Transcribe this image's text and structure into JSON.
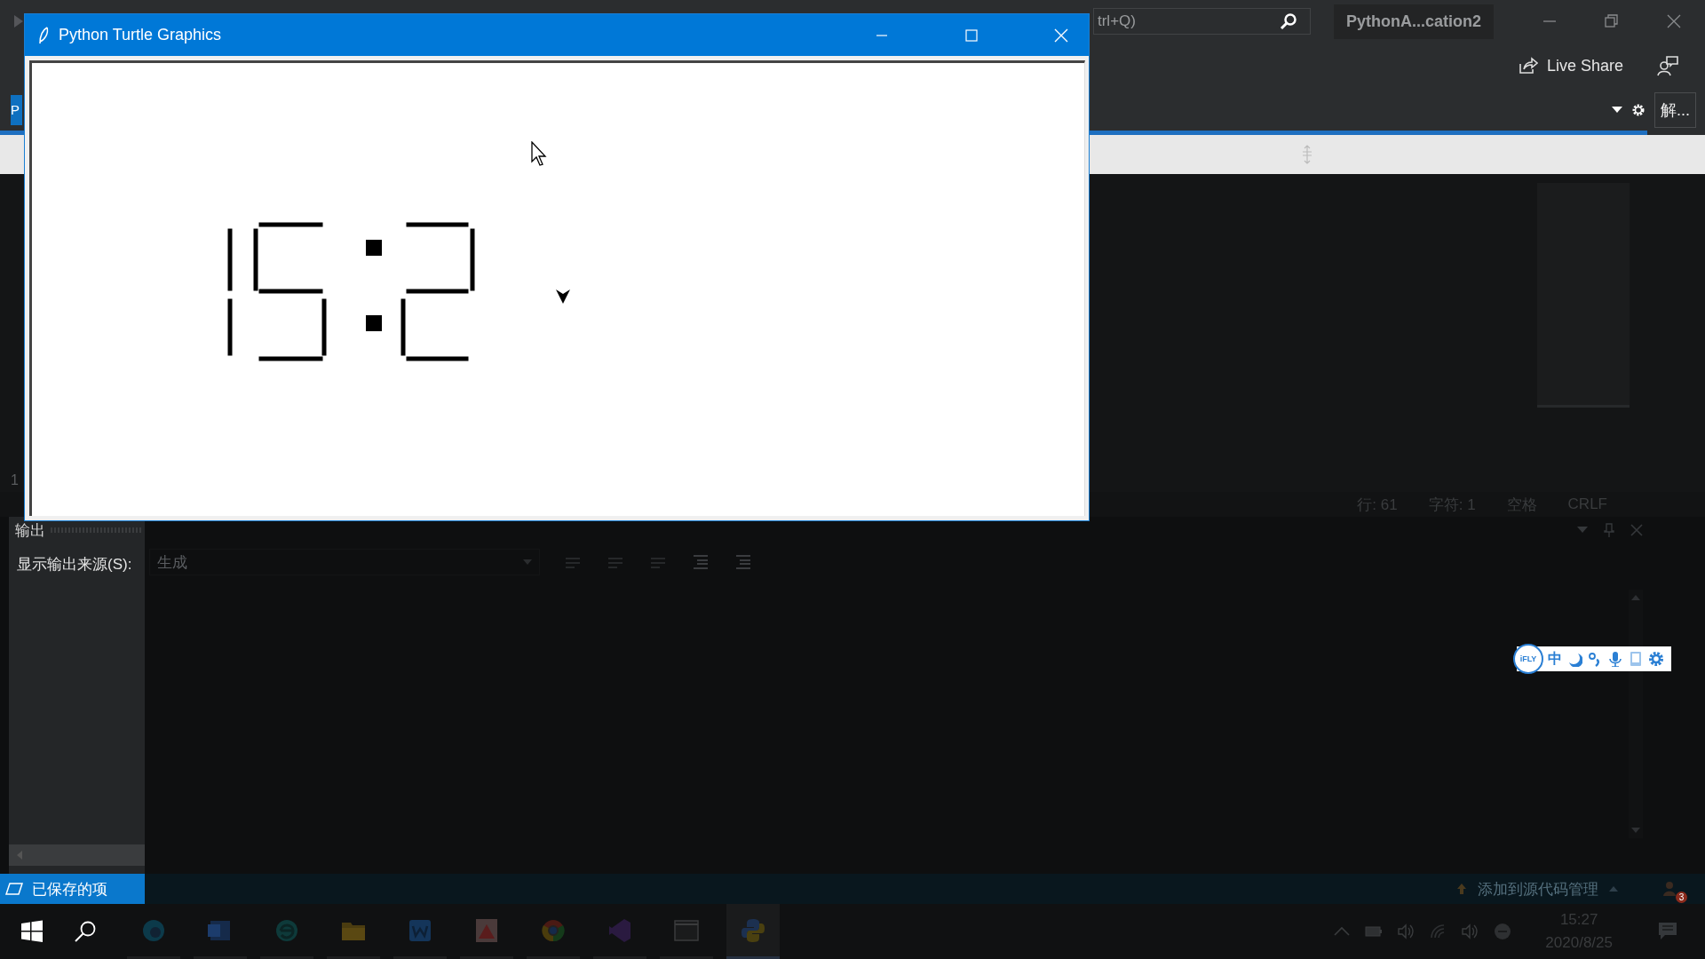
{
  "turtle_window": {
    "title": "Python Turtle Graphics"
  },
  "ide": {
    "search": {
      "value": "trl+Q)"
    },
    "solution_title": "PythonA...cation2",
    "live_share": "Live Share",
    "solution_button": "解...",
    "left_tab": "P",
    "line_number_fragment": "1",
    "status_items": [
      "行: 61",
      "字符: 1",
      "空格",
      "CRLF"
    ]
  },
  "output_panel": {
    "title": "输出",
    "source_label": "显示输出来源(S):",
    "source_value": "生成"
  },
  "status_bar": {
    "saved": "已保存的项",
    "source_control": "添加到源代码管理",
    "notification_count": "3"
  },
  "ime_toolbar": {
    "logo": "iFLY",
    "mode": "中"
  },
  "taskbar": {
    "apps": [
      {
        "kind": "edge",
        "active": false
      },
      {
        "kind": "word",
        "active": false
      },
      {
        "kind": "ie",
        "active": false
      },
      {
        "kind": "folder",
        "active": false
      },
      {
        "kind": "wps",
        "active": false
      },
      {
        "kind": "paint",
        "active": false
      },
      {
        "kind": "chrome",
        "active": false
      },
      {
        "kind": "vs",
        "active": false
      },
      {
        "kind": "terminal",
        "active": false
      },
      {
        "kind": "python",
        "active": true
      }
    ],
    "time": "15:27",
    "date": "2020/8/25"
  }
}
